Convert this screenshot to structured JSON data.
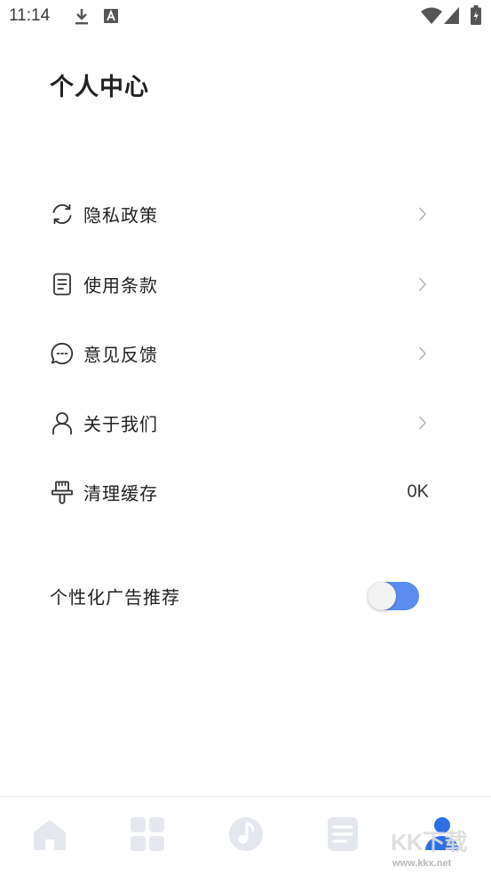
{
  "status_bar": {
    "time": "11:14",
    "icons": [
      "download-icon",
      "a-notification-icon",
      "wifi-icon",
      "signal-icon",
      "battery-charging-icon"
    ]
  },
  "page": {
    "title": "个人中心"
  },
  "menu": {
    "items": [
      {
        "label": "隐私政策",
        "icon": "refresh-icon"
      },
      {
        "label": "使用条款",
        "icon": "document-icon"
      },
      {
        "label": "意见反馈",
        "icon": "chat-bubble-icon"
      },
      {
        "label": "关于我们",
        "icon": "person-icon"
      },
      {
        "label": "清理缓存",
        "icon": "brush-icon",
        "value": "0K"
      }
    ]
  },
  "settings": {
    "ad_label": "个性化广告推荐",
    "ad_enabled": true
  },
  "bottom_nav": {
    "items": [
      "home-icon",
      "grid-icon",
      "music-icon",
      "list-icon",
      "profile-icon"
    ],
    "active_index": 4
  },
  "watermark": {
    "text": "KK下载",
    "url": "www.kkx.net"
  },
  "colors": {
    "accent": "#5b8def",
    "nav_inactive": "#e4e7ee",
    "nav_active": "#2f6fe4",
    "text": "#222222"
  }
}
